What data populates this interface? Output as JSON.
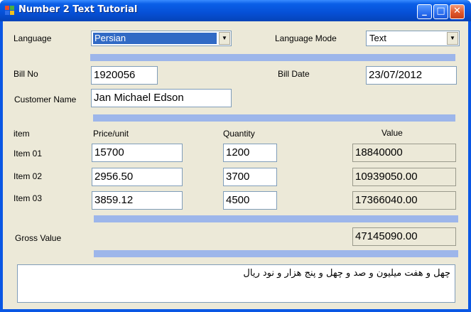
{
  "window": {
    "title": "Number 2 Text Tutorial",
    "minimize_glyph": "_",
    "maximize_glyph": "□",
    "close_glyph": "✕"
  },
  "language": {
    "label": "Language",
    "value": "Persian"
  },
  "language_mode": {
    "label": "Language Mode",
    "value": "Text"
  },
  "bill": {
    "no_label": "Bill No",
    "no_value": "1920056",
    "date_label": "Bill Date",
    "date_value": "23/07/2012"
  },
  "customer": {
    "label": "Customer Name",
    "value": "Jan Michael Edson"
  },
  "table": {
    "headers": {
      "item": "item",
      "price": "Price/unit",
      "quantity": "Quantity",
      "value": "Value"
    },
    "rows": [
      {
        "item": "Item 01",
        "price": "15700",
        "quantity": "1200",
        "value": "18840000"
      },
      {
        "item": "Item 02",
        "price": "2956.50",
        "quantity": "3700",
        "value": "10939050.00"
      },
      {
        "item": "Item 03",
        "price": "3859.12",
        "quantity": "4500",
        "value": "17366040.00"
      }
    ]
  },
  "gross": {
    "label": "Gross Value",
    "value": "47145090.00"
  },
  "result_text": "چهل و هفت ميليون و صد و چهل و پنج هزار و نود ريال",
  "colors": {
    "separator": "#9db6ea",
    "selection": "#316ac5",
    "titlebar": "#0650d6"
  }
}
